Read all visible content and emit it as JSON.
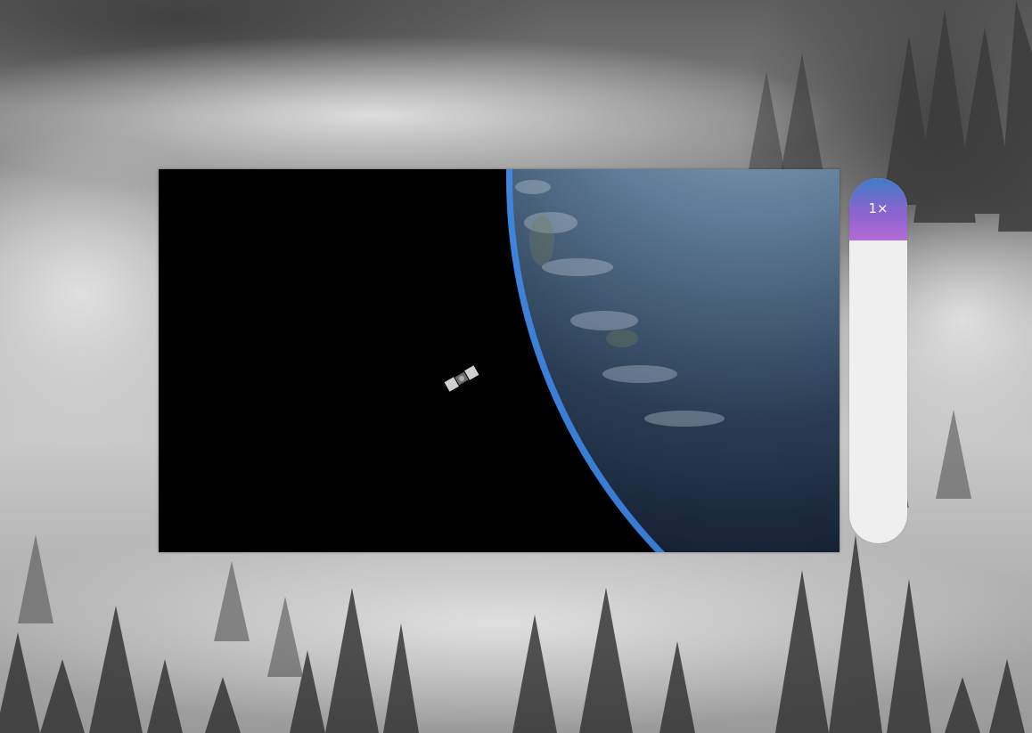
{
  "speed_control": {
    "label": "1×",
    "fill_fraction": 0.17,
    "fill_colors": [
      "#3f7cc6",
      "#8a63cf",
      "#b16ad4"
    ]
  },
  "icons": {
    "video_subject": "earth-satellite-image",
    "background": "foggy-forest-image"
  }
}
